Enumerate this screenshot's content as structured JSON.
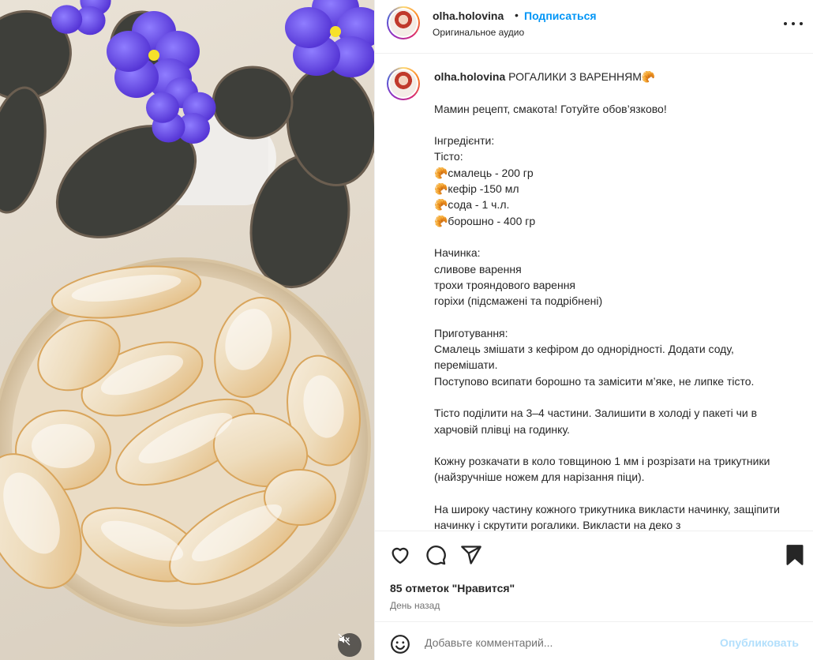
{
  "post": {
    "username": "olha.holovina",
    "separator": "•",
    "follow_label": "Подписаться",
    "audio_label": "Оригинальное аудио",
    "caption_title": "РОГАЛИКИ З ВАРЕННЯМ🥐",
    "caption_body": "Мамин рецепт, смакота! Готуйте обов’язково!\n\nІнгредієнти:\nТісто:\n🥐смалець - 200 гр\n🥐кефір -150 мл\n🥐сода - 1 ч.л.\n🥐борошно - 400 гр\n\nНачинка:\nсливове варення\nтрохи трояндового варення\nгоріхи (підсмажені та подрібнені)\n\nПриготування:\nСмалець змішати з кефіром до однорідності. Додати соду, перемішати.\nПоступово всипати борошно та замісити м’яке, не липке тісто.\n\nТісто поділити на 3–4 частини. Залишити в холоді у пакеті чи в харчовій плівці на годинку.\n\nКожну розкачати в коло товщиною 1 мм і розрізати на трикутники (найзручніше ножем для нарізання піци).\n\nНа широку частину кожного трикутника викласти начинку, защіпити начинку і скрутити рогалики. Викласти на деко з"
  },
  "engagement": {
    "likes_label": "85 отметок \"Нравится\"",
    "time_label": "День назад"
  },
  "comment": {
    "placeholder": "Добавьте комментарий...",
    "publish_label": "Опубликовать"
  },
  "icons": {
    "more": "more-options-icon",
    "like": "heart-icon",
    "comment": "comment-icon",
    "share": "share-icon",
    "save": "bookmark-icon",
    "emoji": "emoji-icon",
    "mute": "sound-off-icon"
  },
  "colors": {
    "link_blue": "#0095f6",
    "publish_disabled": "#b2dffc",
    "text": "#262626",
    "secondary_text": "#737373"
  }
}
